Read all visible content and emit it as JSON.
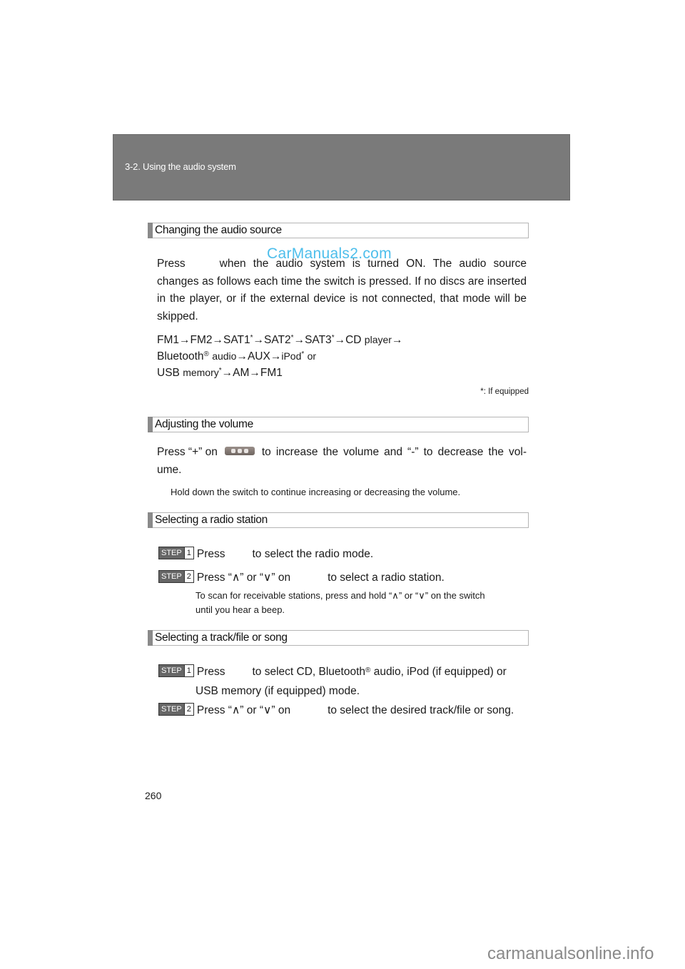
{
  "header": {
    "title": "3-2. Using the audio system"
  },
  "sections": [
    {
      "title": "Changing the audio source",
      "paragraph": {
        "press": "Press",
        "rest_line1": "when the audio system is turned ON. The audio source",
        "rest": "changes as follows each time the switch is pressed. If no discs are inserted in the player, or if the external device is not connected, that mode will be skipped."
      },
      "flow_lines": [
        "FM1→FM2→SAT1*→SAT2*→SAT3*→CD player→",
        "Bluetooth® audio→AUX→iPod* or",
        "USB memory*→AM→FM1"
      ],
      "footnote": "*: If equipped"
    },
    {
      "title": "Adjusting the volume",
      "paragraph": {
        "part1": "Press “+” on",
        "part2": "to increase the volume and “-” to decrease the vol-",
        "part3": "ume."
      },
      "note": "Hold down the switch to continue increasing or decreasing the volume."
    },
    {
      "title": "Selecting a radio station",
      "steps": [
        {
          "badge": "STEP",
          "number": "1",
          "press": "Press",
          "text": "to select the radio mode."
        },
        {
          "badge": "STEP",
          "number": "2",
          "press": "Press “∧” or “∨” on",
          "text": "to select a radio station."
        }
      ],
      "note_lines": [
        "To scan for receivable stations, press and hold “∧” or “∨” on the switch",
        "until you hear a beep."
      ]
    },
    {
      "title": "Selecting a track/file or song",
      "steps": [
        {
          "badge": "STEP",
          "number": "1",
          "press": "Press",
          "text": "to select CD, Bluetooth® audio, iPod (if equipped) or",
          "cont": "USB memory (if equipped) mode."
        },
        {
          "badge": "STEP",
          "number": "2",
          "press": "Press “∧” or “∨” on",
          "text": "to select the desired track/file or song."
        }
      ]
    }
  ],
  "page_number": "260",
  "watermarks": {
    "top": "CarManuals2.com",
    "bottom": "carmanualsonline.info"
  },
  "icons": {
    "volume_switch": "volume-switch-icon",
    "step_badge": "step-badge"
  },
  "colors": {
    "header_bg": "#7a7a7a",
    "section_bar": "#8a8a8a",
    "watermark_top": "#2fb3e8",
    "watermark_bottom": "#8a8a8a"
  }
}
